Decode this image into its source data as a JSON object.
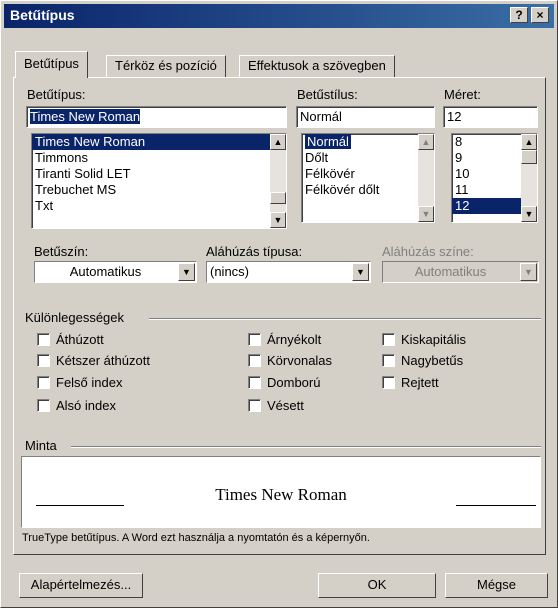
{
  "window": {
    "title": "Betűtípus",
    "help_label": "?",
    "close_label": "×"
  },
  "tabs": [
    {
      "label": "Betűtípus",
      "active": true
    },
    {
      "label": "Térköz és pozíció",
      "active": false
    },
    {
      "label": "Effektusok a szövegben",
      "active": false
    }
  ],
  "font": {
    "label": "Betűtípus:",
    "value": "Times New Roman",
    "items": [
      "Times New Roman",
      "Timmons",
      "Tiranti Solid LET",
      "Trebuchet MS",
      "Txt"
    ]
  },
  "style": {
    "label": "Betűstílus:",
    "value": "Normál",
    "items": [
      "Normál",
      "Dőlt",
      "Félkövér",
      "Félkövér dőlt"
    ]
  },
  "size": {
    "label": "Méret:",
    "value": "12",
    "items": [
      "8",
      "9",
      "10",
      "11",
      "12"
    ]
  },
  "color": {
    "label": "Betűszín:",
    "value": "Automatikus"
  },
  "underline": {
    "label": "Aláhúzás típusa:",
    "value": "(nincs)"
  },
  "underline_color": {
    "label": "Aláhúzás színe:",
    "value": "Automatikus"
  },
  "effects": {
    "label": "Különlegességek",
    "col1": [
      "Áthúzott",
      "Kétszer áthúzott",
      "Felső index",
      "Alsó index"
    ],
    "col2": [
      "Árnyékolt",
      "Körvonalas",
      "Domború",
      "Vésett"
    ],
    "col3": [
      "Kiskapitális",
      "Nagybetűs",
      "Rejtett"
    ]
  },
  "preview": {
    "label": "Minta",
    "text": "Times New Roman",
    "note": "TrueType betűtípus. A Word ezt használja a nyomtatón és a képernyőn."
  },
  "buttons": {
    "default": "Alapértelmezés...",
    "ok": "OK",
    "cancel": "Mégse"
  }
}
